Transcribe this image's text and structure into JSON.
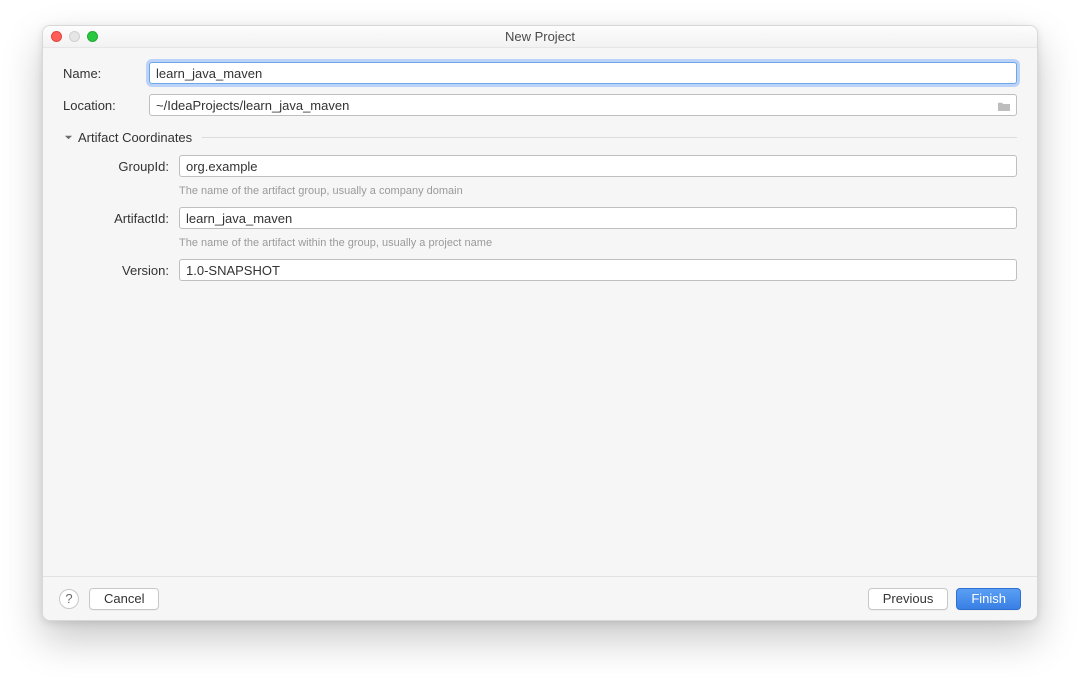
{
  "window": {
    "title": "New Project"
  },
  "fields": {
    "name": {
      "label": "Name:",
      "value": "learn_java_maven"
    },
    "location": {
      "label": "Location:",
      "value": "~/IdeaProjects/learn_java_maven"
    }
  },
  "section": {
    "title": "Artifact Coordinates",
    "group": {
      "label": "GroupId:",
      "value": "org.example",
      "hint": "The name of the artifact group, usually a company domain"
    },
    "artifact": {
      "label": "ArtifactId:",
      "value": "learn_java_maven",
      "hint": "The name of the artifact within the group, usually a project name"
    },
    "version": {
      "label": "Version:",
      "value": "1.0-SNAPSHOT"
    }
  },
  "buttons": {
    "help": "?",
    "cancel": "Cancel",
    "previous": "Previous",
    "finish": "Finish"
  }
}
